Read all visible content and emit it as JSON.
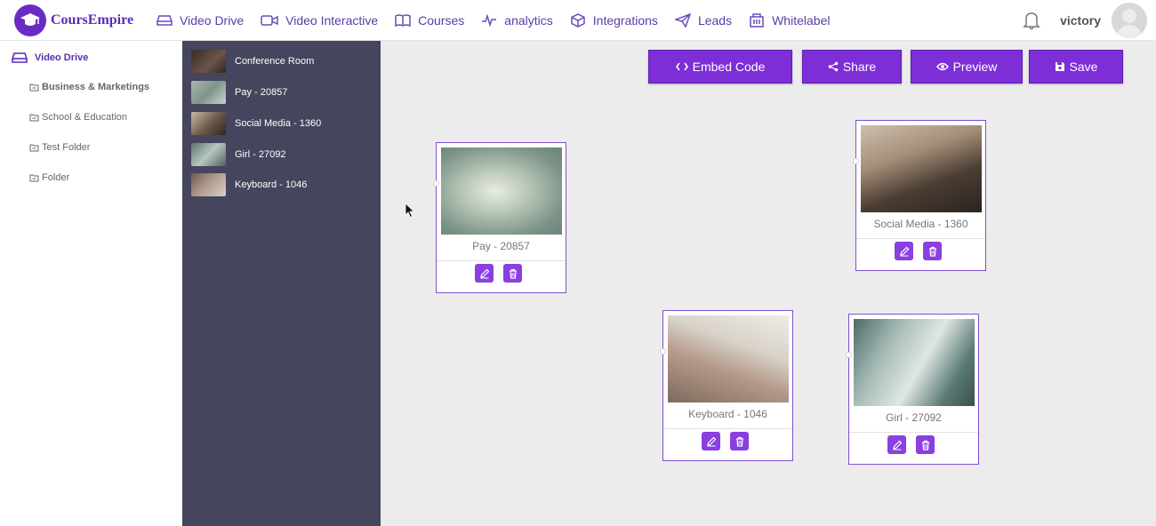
{
  "brand": {
    "name": "CoursEmpire"
  },
  "nav": {
    "items": [
      {
        "label": "Video Drive",
        "icon": "drive-icon"
      },
      {
        "label": "Video Interactive",
        "icon": "video-camera-icon"
      },
      {
        "label": "Courses",
        "icon": "book-icon"
      },
      {
        "label": "analytics",
        "icon": "pulse-icon"
      },
      {
        "label": "Integrations",
        "icon": "cube-icon"
      },
      {
        "label": "Leads",
        "icon": "paper-plane-icon"
      },
      {
        "label": "Whitelabel",
        "icon": "building-icon"
      }
    ],
    "user": "victory"
  },
  "sidebar": {
    "root": "Video Drive",
    "folders": [
      "Business & Marketings",
      "School & Education",
      "Test Folder",
      "Folder"
    ]
  },
  "videos": [
    {
      "title": "Conference Room",
      "thumb_color": "#4a3b35"
    },
    {
      "title": "Pay - 20857",
      "thumb_color": "#8fa39a"
    },
    {
      "title": "Social Media - 1360",
      "thumb_color": "#8a7560"
    },
    {
      "title": "Girl - 27092",
      "thumb_color": "#7d8f8a"
    },
    {
      "title": "Keyboard - 1046",
      "thumb_color": "#8f7b70"
    }
  ],
  "toolbar": {
    "embed": "Embed Code",
    "share": "Share",
    "preview": "Preview",
    "save": "Save"
  },
  "nodes": [
    {
      "title": "Pay - 20857"
    },
    {
      "title": "Social Media - 1360"
    },
    {
      "title": "Keyboard - 1046"
    },
    {
      "title": "Girl - 27092"
    }
  ],
  "colors": {
    "accent": "#7d2ed7",
    "panel": "#45455e",
    "brand": "#5b2bb5"
  }
}
